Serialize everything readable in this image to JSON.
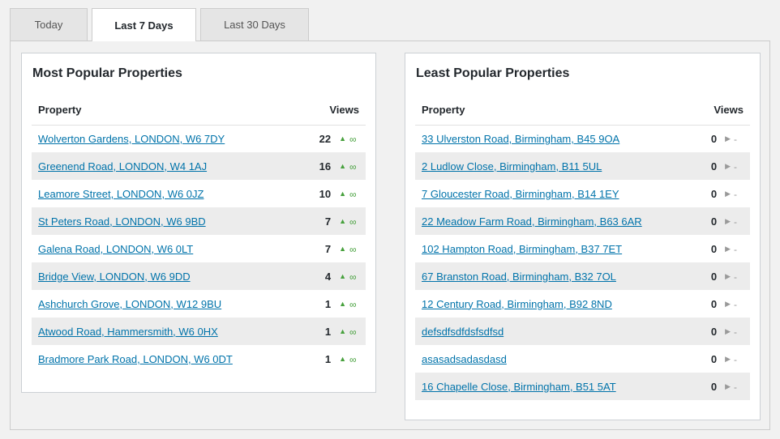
{
  "tabs": [
    {
      "label": "Today",
      "active": false
    },
    {
      "label": "Last 7 Days",
      "active": true
    },
    {
      "label": "Last 30 Days",
      "active": false
    }
  ],
  "most_popular": {
    "title": "Most Popular Properties",
    "col_property": "Property",
    "col_views": "Views",
    "rows": [
      {
        "property": "Wolverton Gardens, LONDON, W6 7DY",
        "views": "22",
        "trend": "up",
        "change": "∞"
      },
      {
        "property": "Greenend Road, LONDON, W4 1AJ",
        "views": "16",
        "trend": "up",
        "change": "∞"
      },
      {
        "property": "Leamore Street, LONDON, W6 0JZ",
        "views": "10",
        "trend": "up",
        "change": "∞"
      },
      {
        "property": "St Peters Road, LONDON, W6 9BD",
        "views": "7",
        "trend": "up",
        "change": "∞"
      },
      {
        "property": "Galena Road, LONDON, W6 0LT",
        "views": "7",
        "trend": "up",
        "change": "∞"
      },
      {
        "property": "Bridge View, LONDON, W6 9DD",
        "views": "4",
        "trend": "up",
        "change": "∞"
      },
      {
        "property": "Ashchurch Grove, LONDON, W12 9BU",
        "views": "1",
        "trend": "up",
        "change": "∞"
      },
      {
        "property": "Atwood Road, Hammersmith, W6 0HX",
        "views": "1",
        "trend": "up",
        "change": "∞"
      },
      {
        "property": "Bradmore Park Road, LONDON, W6 0DT",
        "views": "1",
        "trend": "up",
        "change": "∞"
      }
    ]
  },
  "least_popular": {
    "title": "Least Popular Properties",
    "col_property": "Property",
    "col_views": "Views",
    "rows": [
      {
        "property": "33 Ulverston Road, Birmingham, B45 9OA",
        "views": "0",
        "trend": "flat",
        "change": "-"
      },
      {
        "property": "2 Ludlow Close, Birmingham, B11 5UL",
        "views": "0",
        "trend": "flat",
        "change": "-"
      },
      {
        "property": "7 Gloucester Road, Birmingham, B14 1EY",
        "views": "0",
        "trend": "flat",
        "change": "-"
      },
      {
        "property": "22 Meadow Farm Road, Birmingham, B63 6AR",
        "views": "0",
        "trend": "flat",
        "change": "-"
      },
      {
        "property": "102 Hampton Road, Birmingham, B37 7ET",
        "views": "0",
        "trend": "flat",
        "change": "-"
      },
      {
        "property": "67 Branston Road, Birmingham, B32 7OL",
        "views": "0",
        "trend": "flat",
        "change": "-"
      },
      {
        "property": "12 Century Road, Birmingham, B92 8ND",
        "views": "0",
        "trend": "flat",
        "change": "-"
      },
      {
        "property": "defsdfsdfdsfsdfsd",
        "views": "0",
        "trend": "flat",
        "change": "-"
      },
      {
        "property": "asasadsadasdasd",
        "views": "0",
        "trend": "flat",
        "change": "-"
      },
      {
        "property": "16 Chapelle Close, Birmingham, B51 5AT",
        "views": "0",
        "trend": "flat",
        "change": "-"
      }
    ]
  },
  "icons": {
    "trend_up": "up-triangle-icon",
    "trend_flat": "right-triangle-icon"
  },
  "colors": {
    "link": "#0073aa",
    "trend_up": "#46a03c",
    "trend_flat": "#999999",
    "row_alt": "#ececec"
  }
}
